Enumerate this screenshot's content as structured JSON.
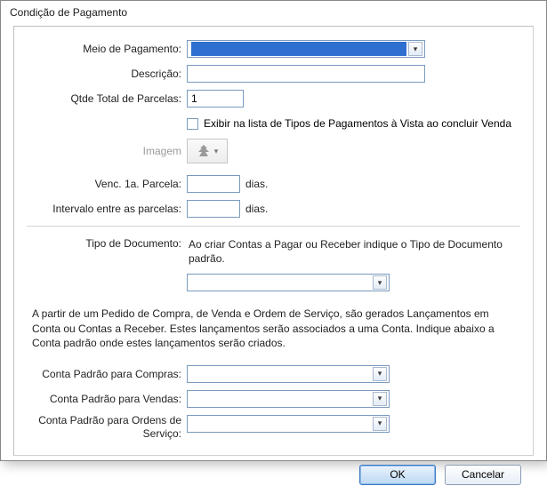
{
  "window": {
    "title": "Condição de Pagamento"
  },
  "labels": {
    "meio_pagamento": "Meio de Pagamento:",
    "descricao": "Descrição:",
    "qtde_parcelas": "Qtde Total de Parcelas:",
    "checkbox_vista": "Exibir na lista de Tipos de Pagamentos à Vista ao concluir Venda",
    "imagem": "Imagem",
    "venc_1a": "Venc. 1a. Parcela:",
    "intervalo": "Intervalo entre as parcelas:",
    "dias": "dias.",
    "tipo_documento": "Tipo de Documento:",
    "tipo_doc_hint": "Ao criar Contas a Pagar ou Receber indique  o Tipo de Documento padrão.",
    "info_paragraph": "A partir de um Pedido de Compra, de Venda e Ordem de Serviço, são gerados Lançamentos em Conta ou Contas a Receber. Estes lançamentos serão associados a uma Conta. Indique abaixo a Conta padrão onde estes lançamentos serão criados.",
    "conta_compras": "Conta Padrão para Compras:",
    "conta_vendas": "Conta Padrão para Vendas:",
    "conta_ordens": "Conta Padrão para Ordens de Serviço:"
  },
  "values": {
    "meio_pagamento": "",
    "descricao": "",
    "qtde_parcelas": "1",
    "checkbox_vista": false,
    "venc_1a": "",
    "intervalo": "",
    "tipo_documento": "",
    "conta_compras": "",
    "conta_vendas": "",
    "conta_ordens": ""
  },
  "buttons": {
    "ok": "OK",
    "cancel": "Cancelar"
  },
  "icons": {
    "dropdown": "▾"
  }
}
